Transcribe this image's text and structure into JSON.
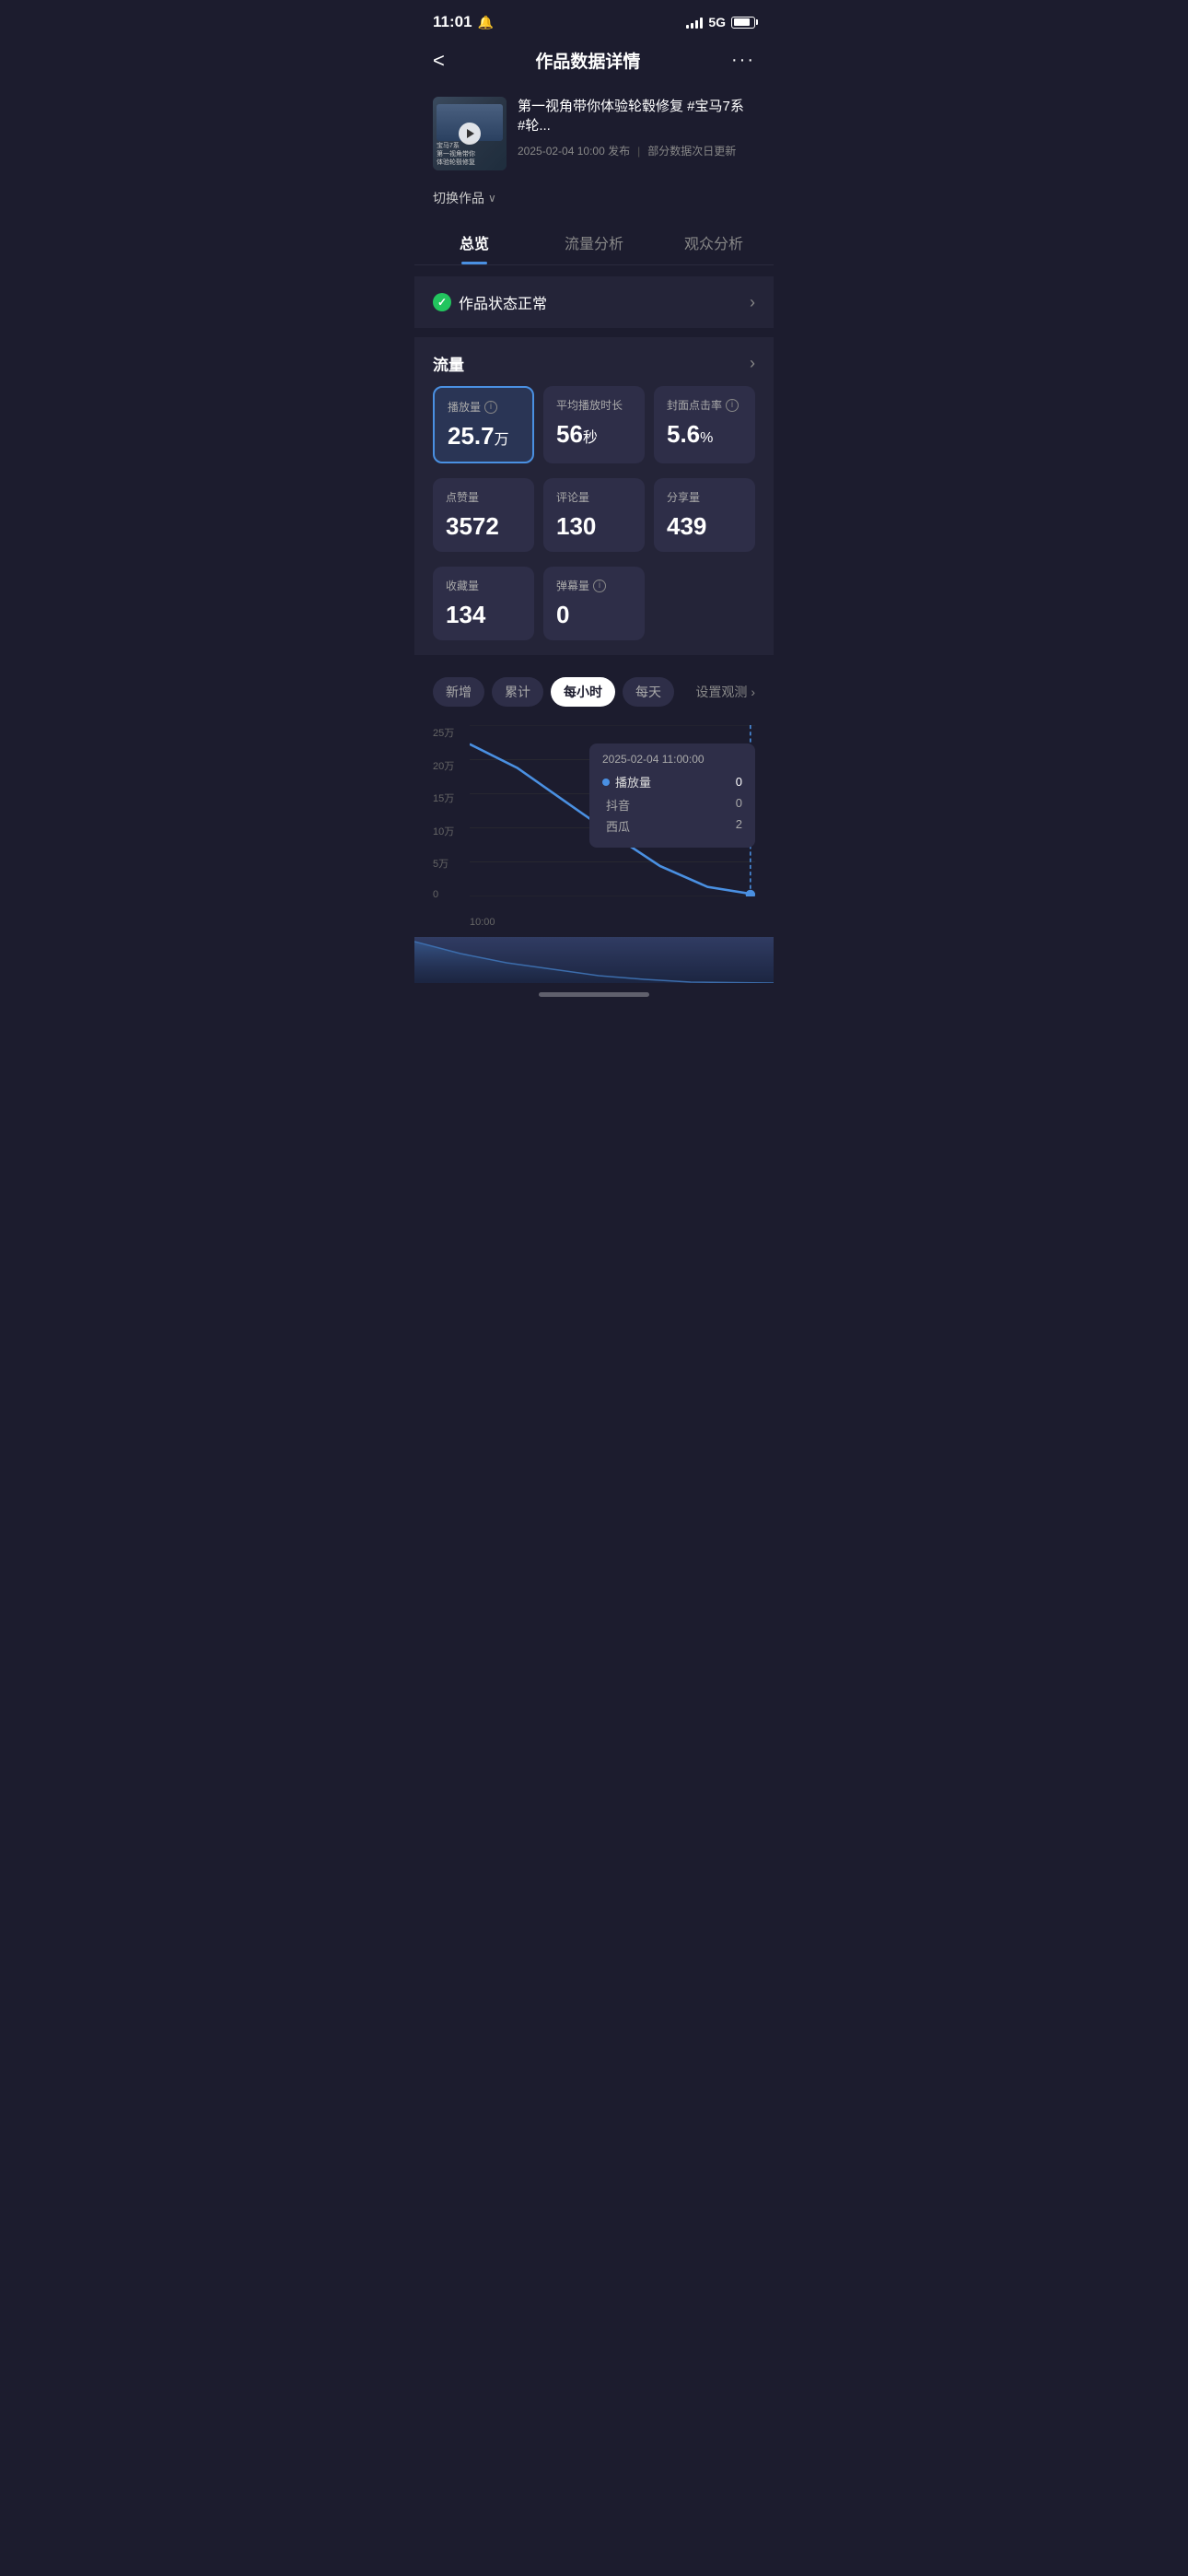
{
  "statusBar": {
    "time": "11:01",
    "network": "5G"
  },
  "header": {
    "title": "作品数据详情",
    "backLabel": "<",
    "moreLabel": "···"
  },
  "video": {
    "title": "第一视角带你体验轮毂修复 #宝马7系 #轮...",
    "publishDate": "2025-02-04 10:00 发布",
    "updateNote": "部分数据次日更新",
    "thumbnailLine1": "宝马7系",
    "thumbnailLine2": "第一视角带你",
    "thumbnailLine3": "体验轮毂修复"
  },
  "switchWork": {
    "label": "切换作品"
  },
  "tabs": [
    {
      "id": "overview",
      "label": "总览",
      "active": true
    },
    {
      "id": "flow",
      "label": "流量分析",
      "active": false
    },
    {
      "id": "audience",
      "label": "观众分析",
      "active": false
    }
  ],
  "statusBanner": {
    "text": "作品状态正常"
  },
  "trafficSection": {
    "title": "流量",
    "metrics": [
      {
        "id": "playcount",
        "label": "播放量",
        "hasInfo": true,
        "value": "25.7",
        "unit": "万",
        "highlighted": true
      },
      {
        "id": "avgduration",
        "label": "平均播放时长",
        "hasInfo": false,
        "value": "56",
        "unit": "秒",
        "highlighted": false
      },
      {
        "id": "ctr",
        "label": "封面点击率",
        "hasInfo": true,
        "value": "5.6",
        "unit": "%",
        "highlighted": false
      },
      {
        "id": "likes",
        "label": "点赞量",
        "hasInfo": false,
        "value": "3572",
        "unit": "",
        "highlighted": false
      },
      {
        "id": "comments",
        "label": "评论量",
        "hasInfo": false,
        "value": "130",
        "unit": "",
        "highlighted": false
      },
      {
        "id": "shares",
        "label": "分享量",
        "hasInfo": false,
        "value": "439",
        "unit": "",
        "highlighted": false
      },
      {
        "id": "favorites",
        "label": "收藏量",
        "hasInfo": false,
        "value": "134",
        "unit": "",
        "highlighted": false
      },
      {
        "id": "danmu",
        "label": "弹幕量",
        "hasInfo": true,
        "value": "0",
        "unit": "",
        "highlighted": false
      }
    ]
  },
  "chartSection": {
    "buttons": [
      {
        "label": "新增",
        "active": false
      },
      {
        "label": "累计",
        "active": false
      },
      {
        "label": "每小时",
        "active": true
      },
      {
        "label": "每天",
        "active": false
      }
    ],
    "settingsLabel": "设置观测",
    "yLabels": [
      "25万",
      "20万",
      "15万",
      "10万",
      "5万",
      "0"
    ],
    "xLabel": "10:00",
    "tooltip": {
      "date": "2025-02-04 11:00:00",
      "rows": [
        {
          "label": "播放量",
          "value": "0",
          "hasDot": true
        },
        {
          "label": "抖音",
          "value": "0",
          "hasDot": false
        },
        {
          "label": "西瓜",
          "value": "2",
          "hasDot": false
        }
      ]
    }
  }
}
